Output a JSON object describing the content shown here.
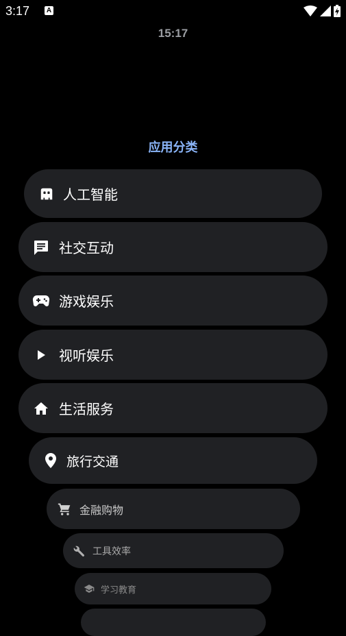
{
  "status_bar": {
    "time": "3:17",
    "notification_icon": "a-letter-icon",
    "notification_letter": "A",
    "icons": [
      "wifi-icon",
      "signal-icon",
      "battery-charging-icon"
    ]
  },
  "header": {
    "time": "15:17"
  },
  "section": {
    "title": "应用分类"
  },
  "categories": [
    {
      "label": "人工智能",
      "icon": "robot-icon"
    },
    {
      "label": "社交互动",
      "icon": "chat-icon"
    },
    {
      "label": "游戏娱乐",
      "icon": "gamepad-icon"
    },
    {
      "label": "视听娱乐",
      "icon": "play-icon"
    },
    {
      "label": "生活服务",
      "icon": "home-icon"
    },
    {
      "label": "旅行交通",
      "icon": "location-pin-icon"
    },
    {
      "label": "金融购物",
      "icon": "shopping-cart-icon"
    },
    {
      "label": "工具效率",
      "icon": "wrench-icon"
    },
    {
      "label": "学习教育",
      "icon": "graduation-cap-icon"
    }
  ]
}
